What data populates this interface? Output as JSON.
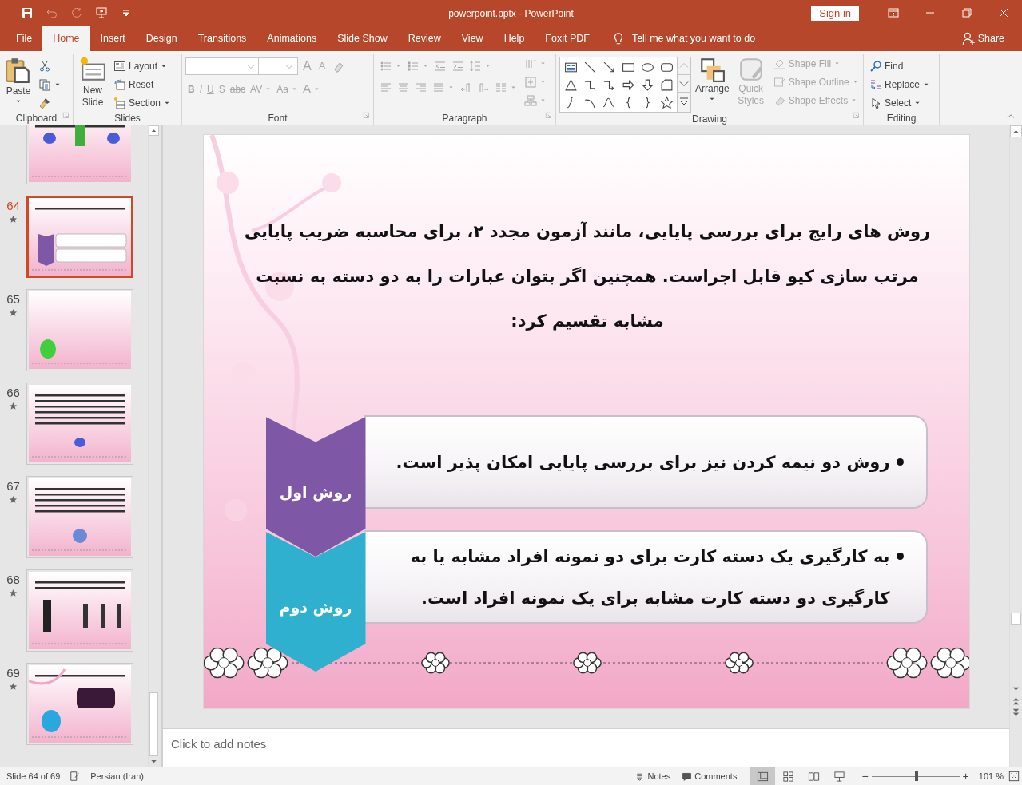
{
  "quick_access": [
    {
      "kind": "save",
      "disabled": false
    },
    {
      "kind": "undo",
      "disabled": true
    },
    {
      "kind": "redo",
      "disabled": true
    },
    {
      "kind": "present",
      "disabled": false
    },
    {
      "kind": "customize",
      "disabled": false
    }
  ],
  "title_bar": {
    "title": "powerpoint.pptx  -  PowerPoint",
    "sign_in": "Sign in"
  },
  "tabs": [
    {
      "label": "File",
      "selected": false
    },
    {
      "label": "Home",
      "selected": true
    },
    {
      "label": "Insert",
      "selected": false
    },
    {
      "label": "Design",
      "selected": false
    },
    {
      "label": "Transitions",
      "selected": false
    },
    {
      "label": "Animations",
      "selected": false
    },
    {
      "label": "Slide Show",
      "selected": false
    },
    {
      "label": "Review",
      "selected": false
    },
    {
      "label": "View",
      "selected": false
    },
    {
      "label": "Help",
      "selected": false
    },
    {
      "label": "Foxit PDF",
      "selected": false
    }
  ],
  "tell_me": "Tell me what you want to do",
  "share": "Share",
  "ribbon": [
    {
      "kind": "clipboard",
      "label": "Clipboard",
      "paste": "Paste"
    },
    {
      "kind": "slides",
      "label": "Slides",
      "new_slide": "New Slide",
      "items": [
        {
          "label": "Layout",
          "menu": true
        },
        {
          "label": "Reset",
          "menu": false
        },
        {
          "label": "Section",
          "menu": true
        }
      ]
    },
    {
      "kind": "font",
      "label": "Font",
      "disabled": true,
      "size_buttons": [
        "A",
        "A"
      ],
      "format_buttons": [
        {
          "label": "B",
          "menu": false
        },
        {
          "label": "I",
          "menu": false
        },
        {
          "label": "U",
          "menu": false
        },
        {
          "label": "S",
          "menu": false
        },
        {
          "label": "abc",
          "menu": false
        },
        {
          "label": "AV",
          "menu": true
        },
        {
          "label": "Aa",
          "menu": true
        },
        {
          "label": "A",
          "menu": true
        }
      ]
    },
    {
      "kind": "paragraph",
      "label": "Paragraph",
      "disabled": true
    },
    {
      "kind": "drawing",
      "label": "Drawing",
      "arrange": "Arrange",
      "quick_styles": {
        "label": "Quick Styles",
        "disabled": true
      },
      "items": [
        {
          "label": "Shape Fill",
          "disabled": true
        },
        {
          "label": "Shape Outline",
          "disabled": true
        },
        {
          "label": "Shape Effects",
          "disabled": true
        }
      ]
    },
    {
      "kind": "editing",
      "label": "Editing",
      "items": [
        {
          "label": "Find",
          "menu": false
        },
        {
          "label": "Replace",
          "menu": true
        },
        {
          "label": "Select",
          "menu": true
        }
      ]
    }
  ],
  "thumbnails": [
    {
      "selected": false
    },
    {
      "number": "64",
      "animated": true,
      "selected": true
    },
    {
      "number": "65",
      "animated": true,
      "selected": false
    },
    {
      "number": "66",
      "animated": true,
      "selected": false
    },
    {
      "number": "67",
      "animated": true,
      "selected": false
    },
    {
      "number": "68",
      "animated": true,
      "selected": false
    },
    {
      "number": "69",
      "animated": true,
      "selected": false
    }
  ],
  "slide": {
    "paragraph": "روش های رایج برای بررسی پایایی، مانند آزمون مجدد ۲، برای محاسبه ضریب پایایی مرتب سازی کیو قابل اجراست. همچنین اگر بتوان عبارات را به دو دسته به نسبت مشابه تقسیم کرد:",
    "steps": [
      {
        "label": "روش اول",
        "color": "#7e57a6",
        "text": "روش دو نیمه کردن نیز برای بررسی پایایی امکان پذیر است."
      },
      {
        "label": "روش دوم",
        "color": "#2fb0cf",
        "text": "به کارگیری یک دسته کارت برای دو نمونه افراد مشابه یا به کارگیری دو دسته کارت مشابه برای یک نمونه افراد است."
      }
    ]
  },
  "notes": {
    "placeholder": "Click to add notes"
  },
  "status_bar": {
    "slide": "Slide 64 of 69",
    "language": "Persian (Iran)",
    "notes": "Notes",
    "comments": "Comments",
    "views": [
      {
        "kind": "normal",
        "selected": true
      },
      {
        "kind": "sorter",
        "selected": false
      },
      {
        "kind": "reading",
        "selected": false
      },
      {
        "kind": "slideshow",
        "selected": false
      }
    ],
    "zoom_out": "−",
    "zoom": {
      "level": 0.51
    },
    "zoom_in": "+",
    "zoom_text": "101 %"
  }
}
